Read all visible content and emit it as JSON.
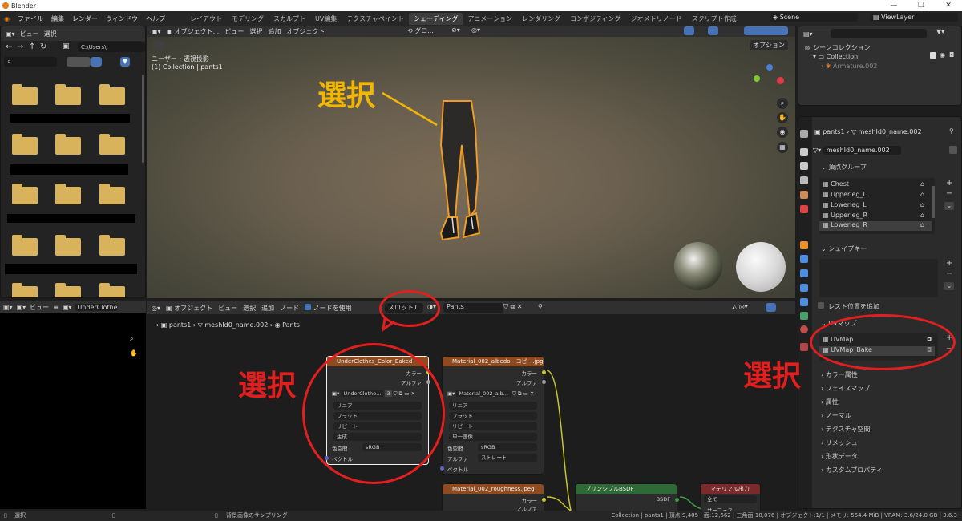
{
  "window": {
    "title": "Blender",
    "controls": [
      "—",
      "❐",
      "✕"
    ]
  },
  "menu": {
    "items": [
      "ファイル",
      "編集",
      "レンダー",
      "ウィンドウ",
      "ヘルプ"
    ]
  },
  "workspaces": {
    "tabs": [
      "レイアウト",
      "モデリング",
      "スカルプト",
      "UV編集",
      "テクスチャペイント",
      "シェーディング",
      "アニメーション",
      "レンダリング",
      "コンポジティング",
      "ジオメトリノード",
      "スクリプト作成"
    ],
    "active": "シェーディング"
  },
  "scene": {
    "label": "Scene",
    "viewlayer": "ViewLayer"
  },
  "filebrowser": {
    "menu": [
      "ビュー",
      "選択"
    ],
    "path": "C:\\Users\\"
  },
  "viewport": {
    "mode": "オブジェクト...",
    "menu": [
      "ビュー",
      "選択",
      "追加",
      "オブジェクト"
    ],
    "transform": "グロ...",
    "view_label": "ユーザー・透視投影",
    "collection_label": "(1) Collection | pants1",
    "options": "オプション",
    "annotation": "選択"
  },
  "outliner": {
    "title": "シーンコレクション",
    "collection": "Collection",
    "armature": "Armature.002"
  },
  "properties": {
    "object": "pants1",
    "mesh": "meshId0_name.002",
    "mesh_field": "meshId0_name.002",
    "vertex_groups_title": "頂点グループ",
    "vertex_groups": [
      "Chest",
      "Upperleg_L",
      "Lowerleg_L",
      "Upperleg_R",
      "Lowerleg_R"
    ],
    "shapekeys_title": "シェイプキー",
    "rest_pos": "レスト位置を追加",
    "uvmaps_title": "UVマップ",
    "uvmaps": [
      "UVMap",
      "UVMap_Bake"
    ],
    "sections": [
      "カラー属性",
      "フェイスマップ",
      "属性",
      "ノーマル",
      "テクスチャ空間",
      "リメッシュ",
      "形状データ",
      "カスタムプロパティ"
    ]
  },
  "nodeeditor": {
    "mode": "オブジェクト",
    "menu": [
      "ビュー",
      "選択",
      "追加",
      "ノード"
    ],
    "use_nodes": "ノードを使用",
    "slot": "スロット1",
    "material": "Pants",
    "breadcrumb": [
      "pants1",
      "meshId0_name.002",
      "Pants"
    ],
    "annotation": "選択"
  },
  "imgpanel": {
    "menu": "ビュー",
    "image": "UnderClothes_Co"
  },
  "nodes": {
    "n1": {
      "title": "UnderClothes_Color_Baked",
      "img": "UnderClothe...",
      "users": "3",
      "out1": "カラー",
      "out2": "アルファ",
      "rows": [
        "リニア",
        "フラット",
        "リピート",
        "生成"
      ],
      "cs_label": "色空間",
      "cs_val": "sRGB",
      "vector": "ベクトル"
    },
    "n2": {
      "title": "Material_002_albedo - コピー.jpg",
      "img": "Material_002_alb...",
      "out1": "カラー",
      "out2": "アルファ",
      "rows": [
        "リニア",
        "フラット",
        "リピート",
        "単一画像"
      ],
      "cs_label": "色空間",
      "cs_val": "sRGB",
      "alpha_label": "アルファ",
      "alpha_val": "ストレート",
      "vector": "ベクトル"
    },
    "n3": {
      "title": "Material_002_roughness.jpeg",
      "out1": "カラー",
      "out2": "アルファ"
    },
    "n4": {
      "title": "プリンシプルBSDF",
      "out": "BSDF"
    },
    "n5": {
      "title": "マテリアル出力",
      "sel": "全て",
      "in": "サーフェス"
    }
  },
  "annotation_text": "選択",
  "status": {
    "left": "選択",
    "middle": "背景画像のサンプリング",
    "right": "Collection | pants1 | 頂点:9,405 | 面:12,662 | 三角面:18,076 | オブジェクト:1/1 | メモリ: 564.4 MiB | VRAM: 3.6/24.0 GB | 3.6.3"
  },
  "colors": {
    "accent": "#e21f1f",
    "annotation_yellow": "#f2b705",
    "node_header": "#8e4b20",
    "bsdf_header": "#2e6a36",
    "output_header": "#7a2a2a"
  }
}
